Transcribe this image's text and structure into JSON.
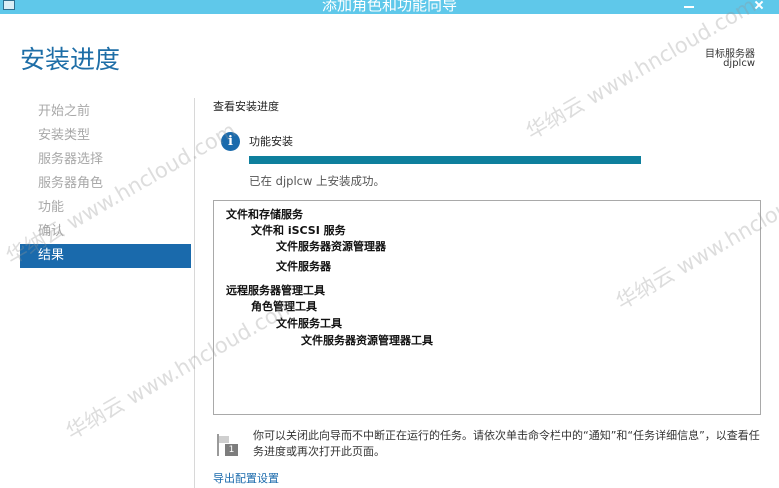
{
  "window": {
    "title": "添加角色和功能向导",
    "controls": [
      "minimize-icon",
      "maximize-icon",
      "close-icon"
    ]
  },
  "header": {
    "page_title": "安装进度",
    "target_label": "目标服务器",
    "target_name": "djplcw"
  },
  "sidebar": {
    "items": [
      {
        "label": "开始之前",
        "active": false
      },
      {
        "label": "安装类型",
        "active": false
      },
      {
        "label": "服务器选择",
        "active": false
      },
      {
        "label": "服务器角色",
        "active": false
      },
      {
        "label": "功能",
        "active": false
      },
      {
        "label": "确认",
        "active": false
      },
      {
        "label": "结果",
        "active": true
      }
    ]
  },
  "main": {
    "section_title": "查看安装进度",
    "feature_label": "功能安装",
    "progress_fraction": 1.0,
    "status_text": "已在 djplcw 上安装成功。",
    "results": [
      {
        "text": "文件和存储服务",
        "level": 0
      },
      {
        "text": "文件和 iSCSI 服务",
        "level": 1
      },
      {
        "text": "文件服务器资源管理器",
        "level": 2
      },
      {
        "text": "文件服务器",
        "level": 2
      },
      {
        "text": "远程服务器管理工具",
        "level": 0
      },
      {
        "text": "角色管理工具",
        "level": 1
      },
      {
        "text": "文件服务工具",
        "level": 2
      },
      {
        "text": "文件服务器资源管理器工具",
        "level": 3
      }
    ],
    "note_badge": "1",
    "note_text": "你可以关闭此向导而不中断正在运行的任务。请依次单击命令栏中的“通知”和“任务详细信息”，以查看任务进度或再次打开此页面。",
    "export_link": "导出配置设置"
  },
  "watermark": {
    "text": "华纳云 www.hncloud.com"
  },
  "colors": {
    "titlebar": "#5fc8ea",
    "accent": "#1a6aac",
    "progress_fill": "#0e7f9d",
    "inactive_nav": "#a8a8a8"
  }
}
